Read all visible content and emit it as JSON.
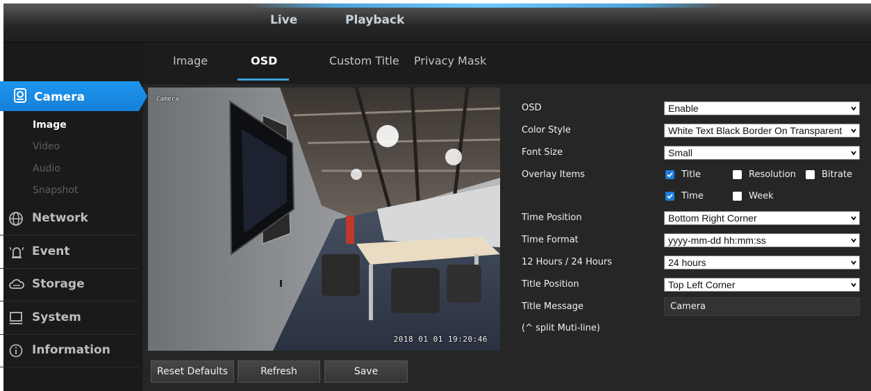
{
  "topnav": {
    "live": "Live",
    "playback": "Playback"
  },
  "tabs": [
    {
      "label": "Image",
      "active": false
    },
    {
      "label": "OSD",
      "active": true
    },
    {
      "label": "Custom Title",
      "active": false
    },
    {
      "label": "Privacy Mask",
      "active": false
    }
  ],
  "sidebar": {
    "camera": {
      "label": "Camera",
      "icon": "camera-icon"
    },
    "subitems": [
      {
        "label": "Image",
        "active": true
      },
      {
        "label": "Video",
        "active": false
      },
      {
        "label": "Audio",
        "active": false
      },
      {
        "label": "Snapshot",
        "active": false
      }
    ],
    "items": [
      {
        "label": "Network",
        "icon": "network-globe-icon"
      },
      {
        "label": "Event",
        "icon": "alarm-bell-icon"
      },
      {
        "label": "Storage",
        "icon": "cloud-storage-icon"
      },
      {
        "label": "System",
        "icon": "monitor-icon"
      },
      {
        "label": "Information",
        "icon": "info-icon"
      }
    ]
  },
  "preview": {
    "osd_title": "Camera",
    "osd_time": "2018 01 01  19:20:46"
  },
  "buttons": {
    "reset": "Reset Defaults",
    "refresh": "Refresh",
    "save": "Save"
  },
  "form": {
    "osd": {
      "label": "OSD",
      "value": "Enable"
    },
    "color_style": {
      "label": "Color Style",
      "value": "White Text Black Border On Transparent"
    },
    "font_size": {
      "label": "Font Size",
      "value": "Small"
    },
    "overlay_items": {
      "label": "Overlay Items",
      "options": [
        {
          "label": "Title",
          "checked": true
        },
        {
          "label": "Resolution",
          "checked": false
        },
        {
          "label": "Bitrate",
          "checked": false
        },
        {
          "label": "Time",
          "checked": true
        },
        {
          "label": "Week",
          "checked": false
        }
      ]
    },
    "time_position": {
      "label": "Time Position",
      "value": "Bottom Right Corner"
    },
    "time_format": {
      "label": "Time Format",
      "value": "yyyy-mm-dd hh:mm:ss"
    },
    "hours": {
      "label": "12 Hours / 24 Hours",
      "value": "24 hours"
    },
    "title_position": {
      "label": "Title Position",
      "value": "Top Left Corner"
    },
    "title_message": {
      "label": "Title Message",
      "value": "Camera"
    },
    "split_hint": "(^ split Muti-line)"
  },
  "colors": {
    "accent": "#1a87e6",
    "tab_underline": "#3aa0e0",
    "background": "#1c1c1c"
  }
}
